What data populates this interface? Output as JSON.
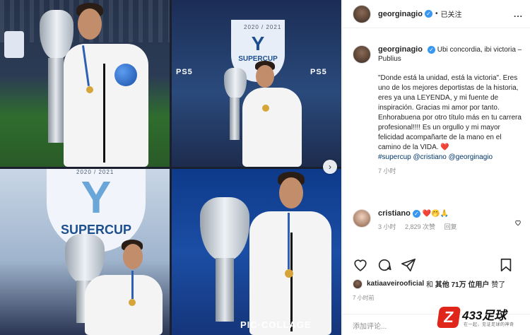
{
  "post": {
    "username": "georginagio",
    "follow_status": "已关注",
    "more_label": "...",
    "caption_lead": "Ubi concordia, ibi victoria – Publius",
    "caption_quote": "\"Donde está la unidad, está la victoria\". Eres uno de los mejores deportistas de la historia, eres ya una LEYENDA, y mi fuente de inspiración. Gracias mi amor por tanto. Enhorabuena por otro título más en tu carrera profesional!!!! Es un orgullo y mi mayor felicidad acompañarte de la mano en el camino de la VIDA. ❤️",
    "hashtags": "#supercup @cristiano @georginagio",
    "caption_time": "7 小时"
  },
  "comment": {
    "username": "cristiano",
    "text": "❤️🤭🙏",
    "time": "3 小时",
    "likes": "2,829 次赞",
    "reply": "回复"
  },
  "likes_line": {
    "user": "katiaaveirooficial",
    "conj": "和",
    "others": "其他 71万 位用户",
    "suffix": "赞了"
  },
  "post_time": "7 小时前",
  "add_comment_placeholder": "添加评论...",
  "collage": {
    "brand_watermark": "PIC·COLLAGE",
    "supercup_text": "SUPERCUP",
    "season_text": "2020 / 2021",
    "console_text": "PS5",
    "next_icon": "chevron-right-icon"
  },
  "watermark": {
    "mark": "Z",
    "text": "433足球",
    "sub": "在一起，见证足球的神奇"
  },
  "colors": {
    "verified_blue": "#3897f0",
    "hashtag_blue": "#00376b",
    "heart_red": "#ed4956",
    "watermark_red": "#e0251b"
  }
}
